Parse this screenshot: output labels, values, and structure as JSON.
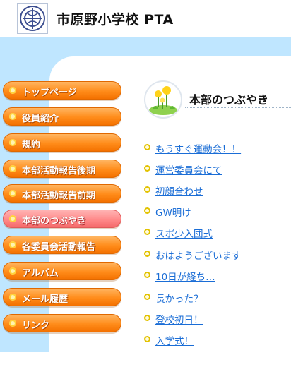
{
  "header": {
    "site_title": "市原野小学校 PTA"
  },
  "nav": {
    "items": [
      {
        "label": "トップページ",
        "active": false
      },
      {
        "label": "役員紹介",
        "active": false
      },
      {
        "label": "規約",
        "active": false
      },
      {
        "label": "本部活動報告後期",
        "active": false
      },
      {
        "label": "本部活動報告前期",
        "active": false
      },
      {
        "label": "本部のつぶやき",
        "active": true
      },
      {
        "label": "各委員会活動報告",
        "active": false
      },
      {
        "label": "アルバム",
        "active": false
      },
      {
        "label": "メール履歴",
        "active": false
      },
      {
        "label": "リンク",
        "active": false
      }
    ]
  },
  "main": {
    "section_title": "本部のつぶやき",
    "icon_name": "dandelion-icon",
    "posts": [
      "もうすぐ運動会！！",
      "運営委員会にて",
      "初顔合わせ",
      "GW明け",
      "スポ少入団式",
      "おはようございます",
      "10日が経ち…",
      "長かった？",
      "登校初日！",
      "入学式！"
    ]
  },
  "colors": {
    "background": "#bfe6ff",
    "nav_orange": "#ff8c1a",
    "nav_active_pink": "#ff8a8a",
    "link_blue": "#1a6dd6"
  }
}
